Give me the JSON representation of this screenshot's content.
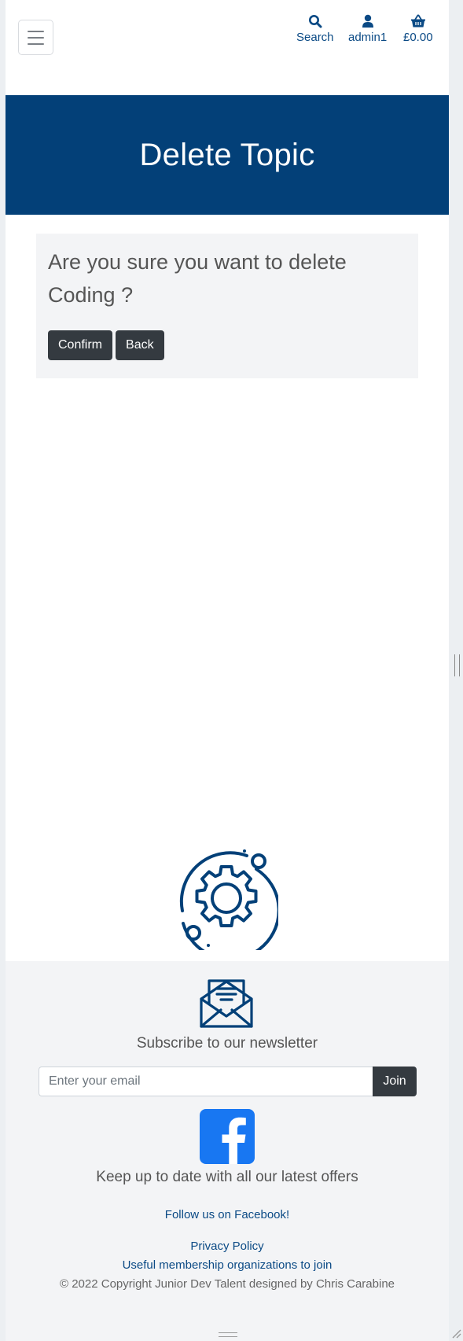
{
  "header": {
    "menu_icon": "hamburger-icon",
    "nav": [
      {
        "icon": "search-icon",
        "label": "Search"
      },
      {
        "icon": "user-icon",
        "label": "admin1"
      },
      {
        "icon": "basket-icon",
        "label": "£0.00"
      }
    ]
  },
  "hero": {
    "title": "Delete Topic"
  },
  "confirm": {
    "question": "Are you sure you want to delete Coding ?",
    "confirm_label": "Confirm",
    "back_label": "Back"
  },
  "decoration": {
    "icon": "gear-orbit-icon"
  },
  "footer": {
    "newsletter_icon": "envelope-newsletter-icon",
    "subscribe_text": "Subscribe to our newsletter",
    "email_placeholder": "Enter your email",
    "join_label": "Join",
    "facebook_icon": "facebook-icon",
    "tagline": "Keep up to date with all our latest offers",
    "facebook_link": "Follow us on Facebook!",
    "privacy_link": "Privacy Policy",
    "membership_link": "Useful membership organizations to join",
    "copyright": "© 2022 Copyright Junior Dev Talent designed by Chris Carabine"
  },
  "colors": {
    "brand": "#034078",
    "link": "#0b4a85",
    "button_dark": "#343a40",
    "facebook": "#1877f2"
  }
}
